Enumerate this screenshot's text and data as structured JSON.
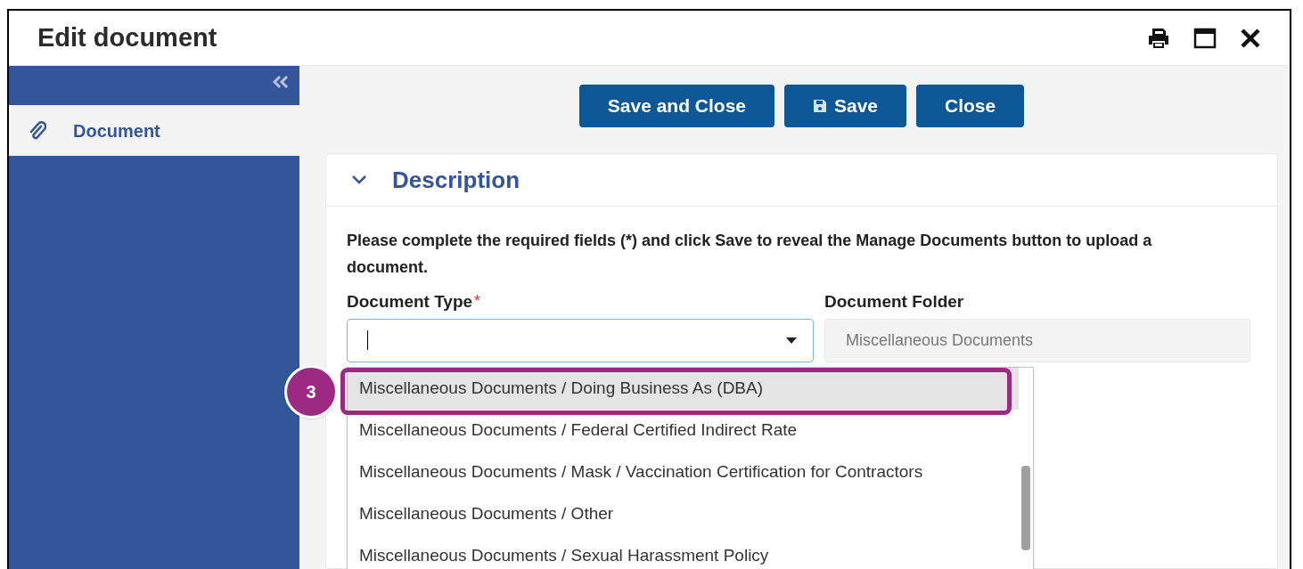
{
  "window": {
    "title": "Edit document"
  },
  "sidebar": {
    "items": [
      {
        "label": "Document",
        "selected": true
      }
    ]
  },
  "toolbar": {
    "buttons": [
      {
        "label": "Save and Close",
        "kind": "text"
      },
      {
        "label": "Save",
        "kind": "save"
      },
      {
        "label": "Close",
        "kind": "text"
      }
    ]
  },
  "section": {
    "title": "Description",
    "expanded": true,
    "instructions": "Please complete the required fields (*) and click Save to reveal the Manage Documents button to upload a document.",
    "document_type": {
      "label": "Document Type",
      "required_mark": "*",
      "options": [
        {
          "label": "Miscellaneous Documents / Doing Business As (DBA)",
          "selected": true
        },
        {
          "label": "Miscellaneous Documents / Federal Certified Indirect Rate",
          "selected": false
        },
        {
          "label": "Miscellaneous Documents / Mask / Vaccination Certification for Contractors",
          "selected": false
        },
        {
          "label": "Miscellaneous Documents / Other",
          "selected": false
        },
        {
          "label": "Miscellaneous Documents / Sexual Harassment Policy",
          "selected": false
        }
      ]
    },
    "document_folder": {
      "label": "Document Folder",
      "value": "Miscellaneous Documents",
      "disabled": true
    }
  },
  "callout": {
    "number": "3"
  }
}
